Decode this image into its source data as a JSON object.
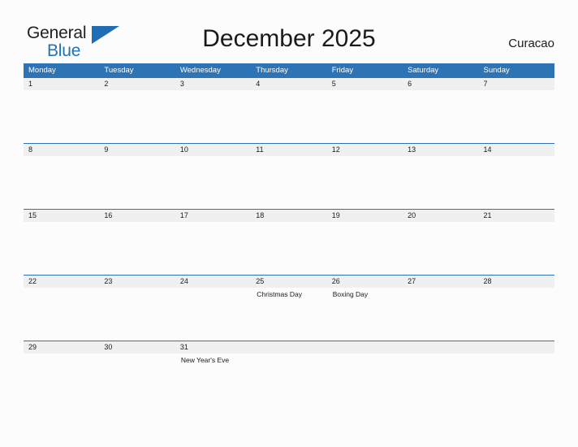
{
  "header": {
    "brand": {
      "name_part_1": "General",
      "name_part_2": "Blue",
      "flag_icon": "blue-flag-triangle",
      "color_dark": "#231f20",
      "color_blue": "#2272b8"
    },
    "title": "December 2025",
    "locale": "Curacao"
  },
  "calendar": {
    "accent_color": "#2e74b5",
    "day_band_color": "#f0f0f0",
    "weekdays": [
      "Monday",
      "Tuesday",
      "Wednesday",
      "Thursday",
      "Friday",
      "Saturday",
      "Sunday"
    ],
    "weeks": [
      {
        "days": [
          {
            "date": "1",
            "events": []
          },
          {
            "date": "2",
            "events": []
          },
          {
            "date": "3",
            "events": []
          },
          {
            "date": "4",
            "events": []
          },
          {
            "date": "5",
            "events": []
          },
          {
            "date": "6",
            "events": []
          },
          {
            "date": "7",
            "events": []
          }
        ]
      },
      {
        "days": [
          {
            "date": "8",
            "events": []
          },
          {
            "date": "9",
            "events": []
          },
          {
            "date": "10",
            "events": []
          },
          {
            "date": "11",
            "events": []
          },
          {
            "date": "12",
            "events": []
          },
          {
            "date": "13",
            "events": []
          },
          {
            "date": "14",
            "events": []
          }
        ]
      },
      {
        "days": [
          {
            "date": "15",
            "events": []
          },
          {
            "date": "16",
            "events": []
          },
          {
            "date": "17",
            "events": []
          },
          {
            "date": "18",
            "events": []
          },
          {
            "date": "19",
            "events": []
          },
          {
            "date": "20",
            "events": []
          },
          {
            "date": "21",
            "events": []
          }
        ]
      },
      {
        "days": [
          {
            "date": "22",
            "events": []
          },
          {
            "date": "23",
            "events": []
          },
          {
            "date": "24",
            "events": []
          },
          {
            "date": "25",
            "events": [
              "Christmas Day"
            ]
          },
          {
            "date": "26",
            "events": [
              "Boxing Day"
            ]
          },
          {
            "date": "27",
            "events": []
          },
          {
            "date": "28",
            "events": []
          }
        ]
      },
      {
        "days": [
          {
            "date": "29",
            "events": []
          },
          {
            "date": "30",
            "events": []
          },
          {
            "date": "31",
            "events": [
              "New Year's Eve"
            ]
          },
          {
            "date": "",
            "events": []
          },
          {
            "date": "",
            "events": []
          },
          {
            "date": "",
            "events": []
          },
          {
            "date": "",
            "events": []
          }
        ]
      }
    ]
  }
}
